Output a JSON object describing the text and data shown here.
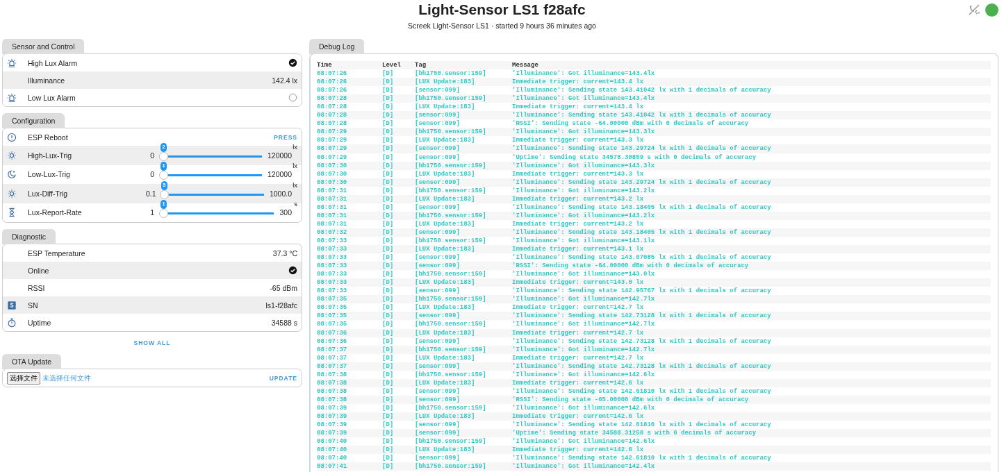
{
  "header": {
    "title": "Light-Sensor LS1 f28afc",
    "subtitle": "Screek Light-Sensor LS1 · started 9 hours 36 minutes ago",
    "connected": true
  },
  "sections": [
    {
      "title": "Sensor and Control",
      "rows": [
        {
          "kind": "switch",
          "label": "High Lux Alarm",
          "checked": true
        },
        {
          "kind": "sensor",
          "label": "Illuminance",
          "value": "142.4 lx"
        },
        {
          "kind": "switch",
          "label": "Low Lux Alarm",
          "checked": false
        }
      ]
    },
    {
      "title": "Configuration",
      "rows": [
        {
          "kind": "button",
          "label": "ESP Reboot",
          "action": "PRESS"
        },
        {
          "kind": "slider",
          "label": "High-Lux-Trig",
          "min": "0",
          "max": "120000",
          "unit": "lx",
          "bubble": "2",
          "level": 0.0
        },
        {
          "kind": "slider",
          "label": "Low-Lux-Trig",
          "min": "0",
          "max": "120000",
          "unit": "lx",
          "bubble": "1",
          "level": 0.0
        },
        {
          "kind": "slider",
          "label": "Lux-Diff-Trig",
          "min": "0.1",
          "max": "1000.0",
          "unit": "lx",
          "bubble": "5",
          "level": 0.005
        },
        {
          "kind": "slider",
          "label": "Lux-Report-Rate",
          "min": "1",
          "max": "300",
          "unit": "s",
          "bubble": "1",
          "level": 0.0
        }
      ]
    },
    {
      "title": "Diagnostic",
      "show_all": "SHOW ALL",
      "rows": [
        {
          "kind": "sensor",
          "label": "ESP Temperature",
          "value": "37.3 °C"
        },
        {
          "kind": "binary",
          "label": "Online",
          "checked": true
        },
        {
          "kind": "sensor",
          "label": "RSSI",
          "value": "-65 dBm"
        },
        {
          "kind": "sensor",
          "label": "SN",
          "value": "ls1-f28afc"
        },
        {
          "kind": "sensor",
          "label": "Uptime",
          "value": "34588 s"
        }
      ]
    },
    {
      "title": "OTA Update",
      "rows": [
        {
          "kind": "file",
          "button": "选择文件",
          "status": "未选择任何文件",
          "action": "UPDATE"
        }
      ]
    }
  ],
  "debug_log": {
    "title": "Debug Log",
    "columns": [
      "Time",
      "Level",
      "Tag",
      "Message"
    ],
    "rows": [
      {
        "time": "08:07:26",
        "level": "[D]",
        "tag": "[bh1750.sensor:159]",
        "message": "'Illuminance': Got illuminance=143.4lx"
      },
      {
        "time": "08:07:26",
        "level": "[D]",
        "tag": "[LUX Update:183]",
        "message": "Immediate trigger: current=143.4 lx"
      },
      {
        "time": "08:07:26",
        "level": "[D]",
        "tag": "[sensor:099]",
        "message": "'Illuminance': Sending state 143.41042 lx with 1 decimals of accuracy"
      },
      {
        "time": "08:07:28",
        "level": "[D]",
        "tag": "[bh1750.sensor:159]",
        "message": "'Illuminance': Got illuminance=143.4lx"
      },
      {
        "time": "08:07:28",
        "level": "[D]",
        "tag": "[LUX Update:183]",
        "message": "Immediate trigger: current=143.4 lx"
      },
      {
        "time": "08:07:28",
        "level": "[D]",
        "tag": "[sensor:099]",
        "message": "'Illuminance': Sending state 143.41042 lx with 1 decimals of accuracy"
      },
      {
        "time": "08:07:28",
        "level": "[D]",
        "tag": "[sensor:099]",
        "message": "'RSSI': Sending state -64.00000 dBm with 0 decimals of accuracy"
      },
      {
        "time": "08:07:29",
        "level": "[D]",
        "tag": "[bh1750.sensor:159]",
        "message": "'Illuminance': Got illuminance=143.3lx"
      },
      {
        "time": "08:07:29",
        "level": "[D]",
        "tag": "[LUX Update:183]",
        "message": "Immediate trigger: current=143.3 lx"
      },
      {
        "time": "08:07:29",
        "level": "[D]",
        "tag": "[sensor:099]",
        "message": "'Illuminance': Sending state 143.29724 lx with 1 decimals of accuracy"
      },
      {
        "time": "08:07:29",
        "level": "[D]",
        "tag": "[sensor:099]",
        "message": "'Uptime': Sending state 34578.30859 s with 0 decimals of accuracy"
      },
      {
        "time": "08:07:30",
        "level": "[D]",
        "tag": "[bh1750.sensor:159]",
        "message": "'Illuminance': Got illuminance=143.3lx"
      },
      {
        "time": "08:07:30",
        "level": "[D]",
        "tag": "[LUX Update:183]",
        "message": "Immediate trigger: current=143.3 lx"
      },
      {
        "time": "08:07:30",
        "level": "[D]",
        "tag": "[sensor:099]",
        "message": "'Illuminance': Sending state 143.29724 lx with 1 decimals of accuracy"
      },
      {
        "time": "08:07:31",
        "level": "[D]",
        "tag": "[bh1750.sensor:159]",
        "message": "'Illuminance': Got illuminance=143.2lx"
      },
      {
        "time": "08:07:31",
        "level": "[D]",
        "tag": "[LUX Update:183]",
        "message": "Immediate trigger: current=143.2 lx"
      },
      {
        "time": "08:07:31",
        "level": "[D]",
        "tag": "[sensor:099]",
        "message": "'Illuminance': Sending state 143.18405 lx with 1 decimals of accuracy"
      },
      {
        "time": "08:07:31",
        "level": "[D]",
        "tag": "[bh1750.sensor:159]",
        "message": "'Illuminance': Got illuminance=143.2lx"
      },
      {
        "time": "08:07:31",
        "level": "[D]",
        "tag": "[LUX Update:183]",
        "message": "Immediate trigger: current=143.2 lx"
      },
      {
        "time": "08:07:32",
        "level": "[D]",
        "tag": "[sensor:099]",
        "message": "'Illuminance': Sending state 143.18405 lx with 1 decimals of accuracy"
      },
      {
        "time": "08:07:33",
        "level": "[D]",
        "tag": "[bh1750.sensor:159]",
        "message": "'Illuminance': Got illuminance=143.1lx"
      },
      {
        "time": "08:07:33",
        "level": "[D]",
        "tag": "[LUX Update:183]",
        "message": "Immediate trigger: current=143.1 lx"
      },
      {
        "time": "08:07:33",
        "level": "[D]",
        "tag": "[sensor:099]",
        "message": "'Illuminance': Sending state 143.07085 lx with 1 decimals of accuracy"
      },
      {
        "time": "08:07:33",
        "level": "[D]",
        "tag": "[sensor:099]",
        "message": "'RSSI': Sending state -64.00000 dBm with 0 decimals of accuracy"
      },
      {
        "time": "08:07:33",
        "level": "[D]",
        "tag": "[bh1750.sensor:159]",
        "message": "'Illuminance': Got illuminance=143.0lx"
      },
      {
        "time": "08:07:33",
        "level": "[D]",
        "tag": "[LUX Update:183]",
        "message": "Immediate trigger: current=143.0 lx"
      },
      {
        "time": "08:07:33",
        "level": "[D]",
        "tag": "[sensor:099]",
        "message": "'Illuminance': Sending state 142.95767 lx with 1 decimals of accuracy"
      },
      {
        "time": "08:07:35",
        "level": "[D]",
        "tag": "[bh1750.sensor:159]",
        "message": "'Illuminance': Got illuminance=142.7lx"
      },
      {
        "time": "08:07:35",
        "level": "[D]",
        "tag": "[LUX Update:183]",
        "message": "Immediate trigger: current=142.7 lx"
      },
      {
        "time": "08:07:35",
        "level": "[D]",
        "tag": "[sensor:099]",
        "message": "'Illuminance': Sending state 142.73128 lx with 1 decimals of accuracy"
      },
      {
        "time": "08:07:35",
        "level": "[D]",
        "tag": "[bh1750.sensor:159]",
        "message": "'Illuminance': Got illuminance=142.7lx"
      },
      {
        "time": "08:07:36",
        "level": "[D]",
        "tag": "[LUX Update:183]",
        "message": "Immediate trigger: current=142.7 lx"
      },
      {
        "time": "08:07:36",
        "level": "[D]",
        "tag": "[sensor:099]",
        "message": "'Illuminance': Sending state 142.73128 lx with 1 decimals of accuracy"
      },
      {
        "time": "08:07:37",
        "level": "[D]",
        "tag": "[bh1750.sensor:159]",
        "message": "'Illuminance': Got illuminance=142.7lx"
      },
      {
        "time": "08:07:37",
        "level": "[D]",
        "tag": "[LUX Update:183]",
        "message": "Immediate trigger: current=142.7 lx"
      },
      {
        "time": "08:07:37",
        "level": "[D]",
        "tag": "[sensor:099]",
        "message": "'Illuminance': Sending state 142.73128 lx with 1 decimals of accuracy"
      },
      {
        "time": "08:07:38",
        "level": "[D]",
        "tag": "[bh1750.sensor:159]",
        "message": "'Illuminance': Got illuminance=142.6lx"
      },
      {
        "time": "08:07:38",
        "level": "[D]",
        "tag": "[LUX Update:183]",
        "message": "Immediate trigger: current=142.6 lx"
      },
      {
        "time": "08:07:38",
        "level": "[D]",
        "tag": "[sensor:099]",
        "message": "'Illuminance': Sending state 142.61810 lx with 1 decimals of accuracy"
      },
      {
        "time": "08:07:38",
        "level": "[D]",
        "tag": "[sensor:099]",
        "message": "'RSSI': Sending state -65.00000 dBm with 0 decimals of accuracy"
      },
      {
        "time": "08:07:39",
        "level": "[D]",
        "tag": "[bh1750.sensor:159]",
        "message": "'Illuminance': Got illuminance=142.6lx"
      },
      {
        "time": "08:07:39",
        "level": "[D]",
        "tag": "[LUX Update:183]",
        "message": "Immediate trigger: current=142.6 lx"
      },
      {
        "time": "08:07:39",
        "level": "[D]",
        "tag": "[sensor:099]",
        "message": "'Illuminance': Sending state 142.61810 lx with 1 decimals of accuracy"
      },
      {
        "time": "08:07:39",
        "level": "[D]",
        "tag": "[sensor:099]",
        "message": "'Uptime': Sending state 34588.31250 s with 0 decimals of accuracy"
      },
      {
        "time": "08:07:40",
        "level": "[D]",
        "tag": "[bh1750.sensor:159]",
        "message": "'Illuminance': Got illuminance=142.6lx"
      },
      {
        "time": "08:07:40",
        "level": "[D]",
        "tag": "[LUX Update:183]",
        "message": "Immediate trigger: current=142.6 lx"
      },
      {
        "time": "08:07:40",
        "level": "[D]",
        "tag": "[sensor:099]",
        "message": "'Illuminance': Sending state 142.61810 lx with 1 decimals of accuracy"
      },
      {
        "time": "08:07:41",
        "level": "[D]",
        "tag": "[bh1750.sensor:159]",
        "message": "'Illuminance': Got illuminance=142.4lx"
      }
    ]
  }
}
